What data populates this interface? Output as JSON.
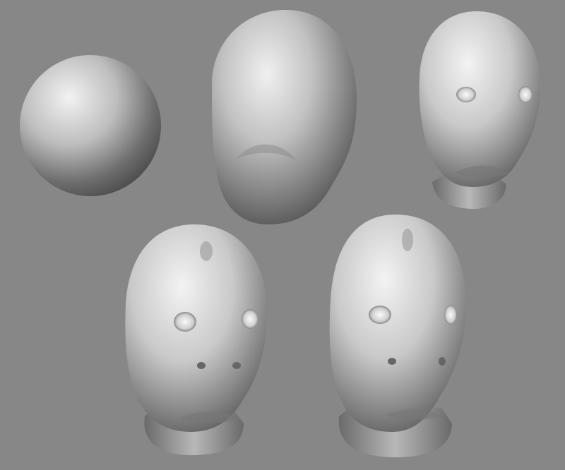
{
  "scene": {
    "background_color": "#878787",
    "surface_color": "#c8c8c8",
    "stages": [
      {
        "name": "sphere-stage",
        "description_icon": "sphere-icon"
      },
      {
        "name": "egg-stage",
        "description_icon": "egg-icon"
      },
      {
        "name": "rough-head-stage",
        "description_icon": "head-icon"
      },
      {
        "name": "detailed-head-stage",
        "description_icon": "head-icon"
      },
      {
        "name": "final-head-stage",
        "description_icon": "head-icon"
      }
    ]
  }
}
